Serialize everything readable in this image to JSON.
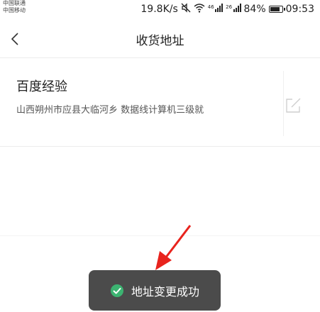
{
  "status_bar": {
    "carrier_1": "中国联通",
    "carrier_2": "中国移动",
    "net_speed": "19.8K/s",
    "mute_icon": "mute-icon",
    "wifi_icon": "wifi-icon",
    "signal_1_tag": "46",
    "signal_2_tag": "26",
    "battery_percent": "84%",
    "battery_level": 0.84,
    "time": "09:53"
  },
  "nav": {
    "back_icon": "chevron-left-icon",
    "title": "收货地址"
  },
  "address": {
    "name": "百度经验",
    "detail": "山西朔州市应县大临河乡 数据线计算机三级就",
    "edit_icon": "edit-icon"
  },
  "toast": {
    "icon": "check-circle-icon",
    "icon_color": "#3cb371",
    "text": "地址变更成功"
  },
  "annotation": {
    "arrow_color": "#e8231d"
  }
}
